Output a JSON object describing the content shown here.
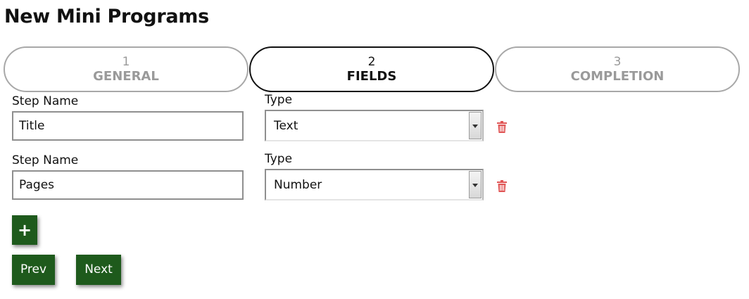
{
  "page": {
    "title": "New Mini Programs"
  },
  "stepper": {
    "steps": [
      {
        "number": "1",
        "label": "GENERAL",
        "state": "inactive"
      },
      {
        "number": "2",
        "label": "FIELDS",
        "state": "active"
      },
      {
        "number": "3",
        "label": "COMPLETION",
        "state": "inactive"
      }
    ]
  },
  "fields": [
    {
      "name_label": "Step Name",
      "name_value": "Title",
      "type_label": "Type",
      "type_value": "Text",
      "delete_icon": "trash-icon"
    },
    {
      "name_label": "Step Name",
      "name_value": "Pages",
      "type_label": "Type",
      "type_value": "Number",
      "delete_icon": "trash-icon"
    }
  ],
  "actions": {
    "add_label": "+",
    "prev_label": "Prev",
    "next_label": "Next"
  },
  "colors": {
    "button_bg": "#1e5a1c",
    "delete_icon": "#e05555",
    "active_step_border": "#111111",
    "inactive_step": "#9a9a9a"
  }
}
